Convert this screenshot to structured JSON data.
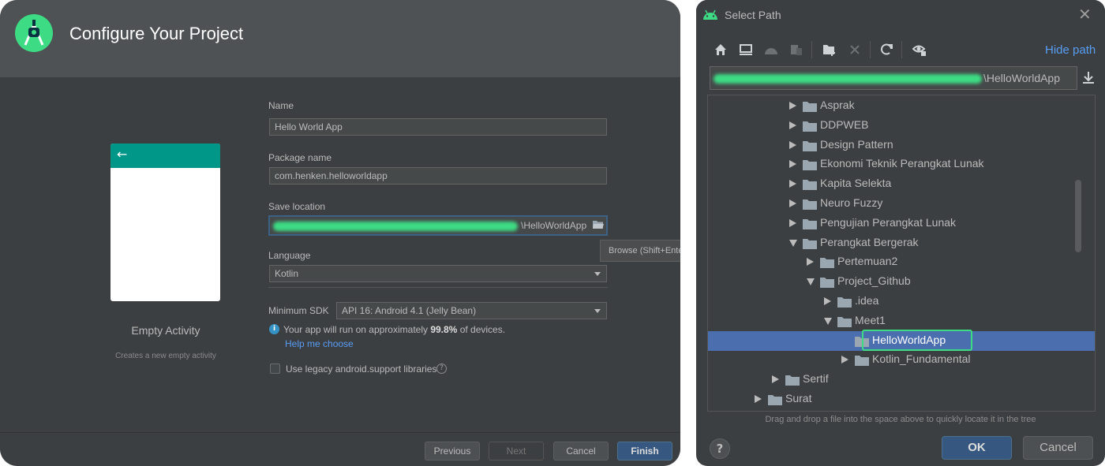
{
  "configure": {
    "title": "Configure Your Project",
    "template": {
      "name": "Empty Activity",
      "description": "Creates a new empty activity",
      "back_glyph": "←"
    },
    "name_label": "Name",
    "name_value": "Hello World App",
    "package_label": "Package name",
    "package_value": "com.henken.helloworldapp",
    "save_label": "Save location",
    "save_value": "\\HelloWorldApp",
    "tooltip": "Browse (Shift+Enter)",
    "language_label": "Language",
    "language_value": "Kotlin",
    "min_sdk_label": "Minimum SDK",
    "min_sdk_value": "API 16: Android 4.1 (Jelly Bean)",
    "info_prefix": "Your app will run on approximately ",
    "info_percent": "99.8%",
    "info_suffix": " of devices.",
    "help_link": "Help me choose",
    "legacy_label": "Use legacy android.support libraries",
    "buttons": {
      "previous": "Previous",
      "next": "Next",
      "cancel": "Cancel",
      "finish": "Finish"
    }
  },
  "select_path": {
    "title": "Select Path",
    "hide_path": "Hide path",
    "path_value": "\\HelloWorldApp",
    "tree": [
      {
        "label": "Asprak",
        "depth": 0,
        "state": "collapsed"
      },
      {
        "label": "DDPWEB",
        "depth": 0,
        "state": "collapsed"
      },
      {
        "label": "Design Pattern",
        "depth": 0,
        "state": "collapsed"
      },
      {
        "label": "Ekonomi Teknik Perangkat Lunak",
        "depth": 0,
        "state": "collapsed"
      },
      {
        "label": "Kapita Selekta",
        "depth": 0,
        "state": "collapsed"
      },
      {
        "label": "Neuro Fuzzy",
        "depth": 0,
        "state": "collapsed"
      },
      {
        "label": "Pengujian Perangkat Lunak",
        "depth": 0,
        "state": "collapsed"
      },
      {
        "label": "Perangkat Bergerak",
        "depth": 0,
        "state": "expanded"
      },
      {
        "label": "Pertemuan2",
        "depth": 1,
        "state": "collapsed"
      },
      {
        "label": "Project_Github",
        "depth": 1,
        "state": "expanded"
      },
      {
        "label": ".idea",
        "depth": 2,
        "state": "collapsed"
      },
      {
        "label": "Meet1",
        "depth": 2,
        "state": "expanded"
      },
      {
        "label": "HelloWorldApp",
        "depth": 3,
        "state": "leaf",
        "selected": true
      },
      {
        "label": "Kotlin_Fundamental",
        "depth": 3,
        "state": "collapsed"
      },
      {
        "label": "Sertif",
        "depth": -1,
        "state": "collapsed"
      },
      {
        "label": "Surat",
        "depth": -2,
        "state": "collapsed"
      }
    ],
    "drag_hint": "Drag and drop a file into the space above to quickly locate it in the tree",
    "help_glyph": "?",
    "ok": "OK",
    "cancel": "Cancel"
  },
  "colors": {
    "window_bg": "#3c3f41",
    "header_bg": "#4e5254",
    "accent_teal": "#009688",
    "android_green": "#3ddc84",
    "selection": "#4b6eaf",
    "link": "#589df6"
  },
  "icons": {
    "toolbar": [
      "home-icon",
      "desktop-icon",
      "android-icon",
      "module-icon",
      "new-folder-icon",
      "delete-icon",
      "refresh-icon",
      "show-hidden-icon"
    ]
  }
}
